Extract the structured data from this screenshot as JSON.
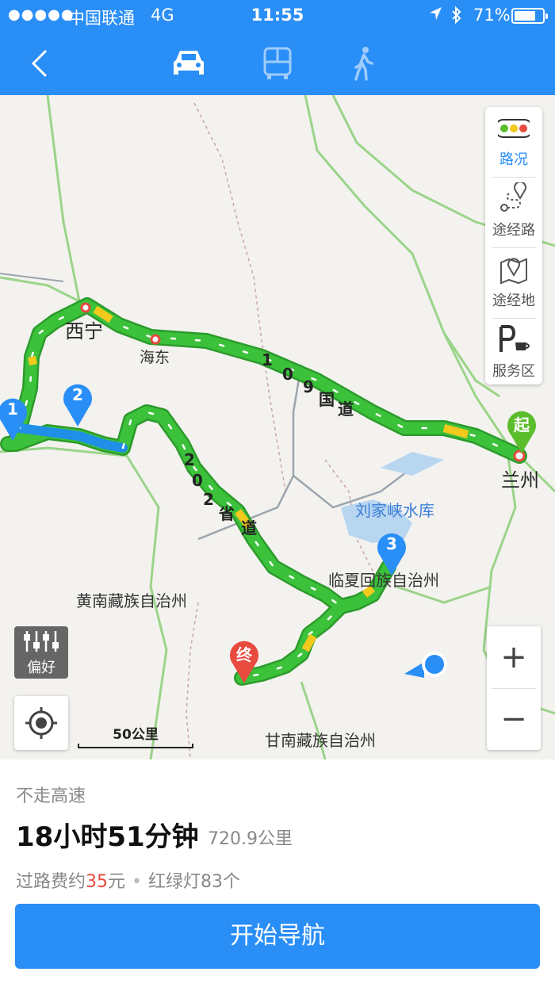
{
  "status_bar": {
    "signal": "●●●●●",
    "carrier": "中国联通",
    "network": "4G",
    "time": "11:55",
    "location_icon": "location-arrow-icon",
    "bluetooth_icon": "bluetooth-icon",
    "battery": "71%"
  },
  "nav": {
    "back_icon": "chevron-left-icon",
    "modes": [
      "car-icon",
      "bus-icon",
      "walk-icon"
    ],
    "selected_mode": "car"
  },
  "map": {
    "cities": [
      {
        "name": "西宁"
      },
      {
        "name": "海东"
      },
      {
        "name": "兰州"
      }
    ],
    "regions": [
      "黄南藏族自治州",
      "临夏回族自治州",
      "甘南藏族自治州"
    ],
    "lake": "刘家峡水库",
    "roads": [
      {
        "chars": [
          "1",
          "0",
          "9",
          "国",
          "道"
        ]
      },
      {
        "chars": [
          "2",
          "0",
          "2",
          "省",
          "道"
        ]
      }
    ],
    "waypoints": [
      "1",
      "2",
      "3"
    ],
    "start_label": "起",
    "end_label": "终",
    "scale_label": "50公里",
    "side_panel": [
      {
        "label": "路况",
        "icon": "traffic-light-icon"
      },
      {
        "label": "途经路",
        "icon": "via-road-icon"
      },
      {
        "label": "途经地",
        "icon": "via-place-icon"
      },
      {
        "label": "服务区",
        "icon": "service-area-icon"
      }
    ],
    "preference_label": "偏好",
    "zoom_in": "+",
    "zoom_out": "−"
  },
  "route": {
    "tag": "不走高速",
    "duration": "18小时51分钟",
    "distance": "720.9公里",
    "toll_prefix": "过路费约",
    "toll_amount": "35",
    "toll_unit": "元",
    "lights_label": "红绿灯83个",
    "start_nav_label": "开始导航"
  },
  "colors": {
    "primary": "#2a8ef7",
    "route_green": "#3cc13b",
    "start_green": "#5bbd2b",
    "end_red": "#e84a3e",
    "pin_blue": "#2a8ef7"
  }
}
